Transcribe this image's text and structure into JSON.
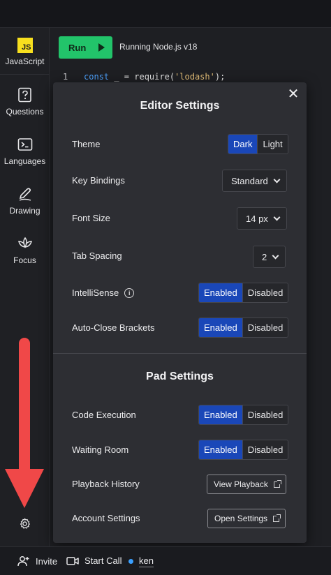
{
  "sidebar": {
    "items": [
      {
        "label": "JavaScript",
        "icon": "javascript-logo-icon"
      },
      {
        "label": "Questions",
        "icon": "question-icon"
      },
      {
        "label": "Languages",
        "icon": "terminal-icon"
      },
      {
        "label": "Drawing",
        "icon": "pen-icon"
      },
      {
        "label": "Focus",
        "icon": "lotus-icon"
      }
    ],
    "js_badge": "JS",
    "settings_icon": "gear-icon"
  },
  "toolbar": {
    "run_label": "Run",
    "status": "Running Node.js v18"
  },
  "editor": {
    "line_number": "1",
    "code_keyword": "const",
    "code_mid": " _ = require(",
    "code_string": "'lodash'",
    "code_end": ");"
  },
  "editor_settings": {
    "title": "Editor Settings",
    "theme": {
      "label": "Theme",
      "options": [
        "Dark",
        "Light"
      ],
      "selected": "Dark"
    },
    "key_bindings": {
      "label": "Key Bindings",
      "value": "Standard"
    },
    "font_size": {
      "label": "Font Size",
      "value": "14 px"
    },
    "tab_spacing": {
      "label": "Tab Spacing",
      "value": "2"
    },
    "intellisense": {
      "label": "IntelliSense",
      "options": [
        "Enabled",
        "Disabled"
      ],
      "selected": "Enabled"
    },
    "auto_close": {
      "label": "Auto-Close Brackets",
      "options": [
        "Enabled",
        "Disabled"
      ],
      "selected": "Enabled"
    }
  },
  "pad_settings": {
    "title": "Pad Settings",
    "code_execution": {
      "label": "Code Execution",
      "options": [
        "Enabled",
        "Disabled"
      ],
      "selected": "Enabled"
    },
    "waiting_room": {
      "label": "Waiting Room",
      "options": [
        "Enabled",
        "Disabled"
      ],
      "selected": "Enabled"
    },
    "playback_history": {
      "label": "Playback History",
      "button": "View Playback"
    },
    "account_settings": {
      "label": "Account Settings",
      "button": "Open Settings"
    }
  },
  "bottom_bar": {
    "invite": "Invite",
    "start_call": "Start Call",
    "user": "ken"
  },
  "colors": {
    "accent": "#1a47b8",
    "run": "#22c46a",
    "annotation_arrow": "#f04848"
  }
}
